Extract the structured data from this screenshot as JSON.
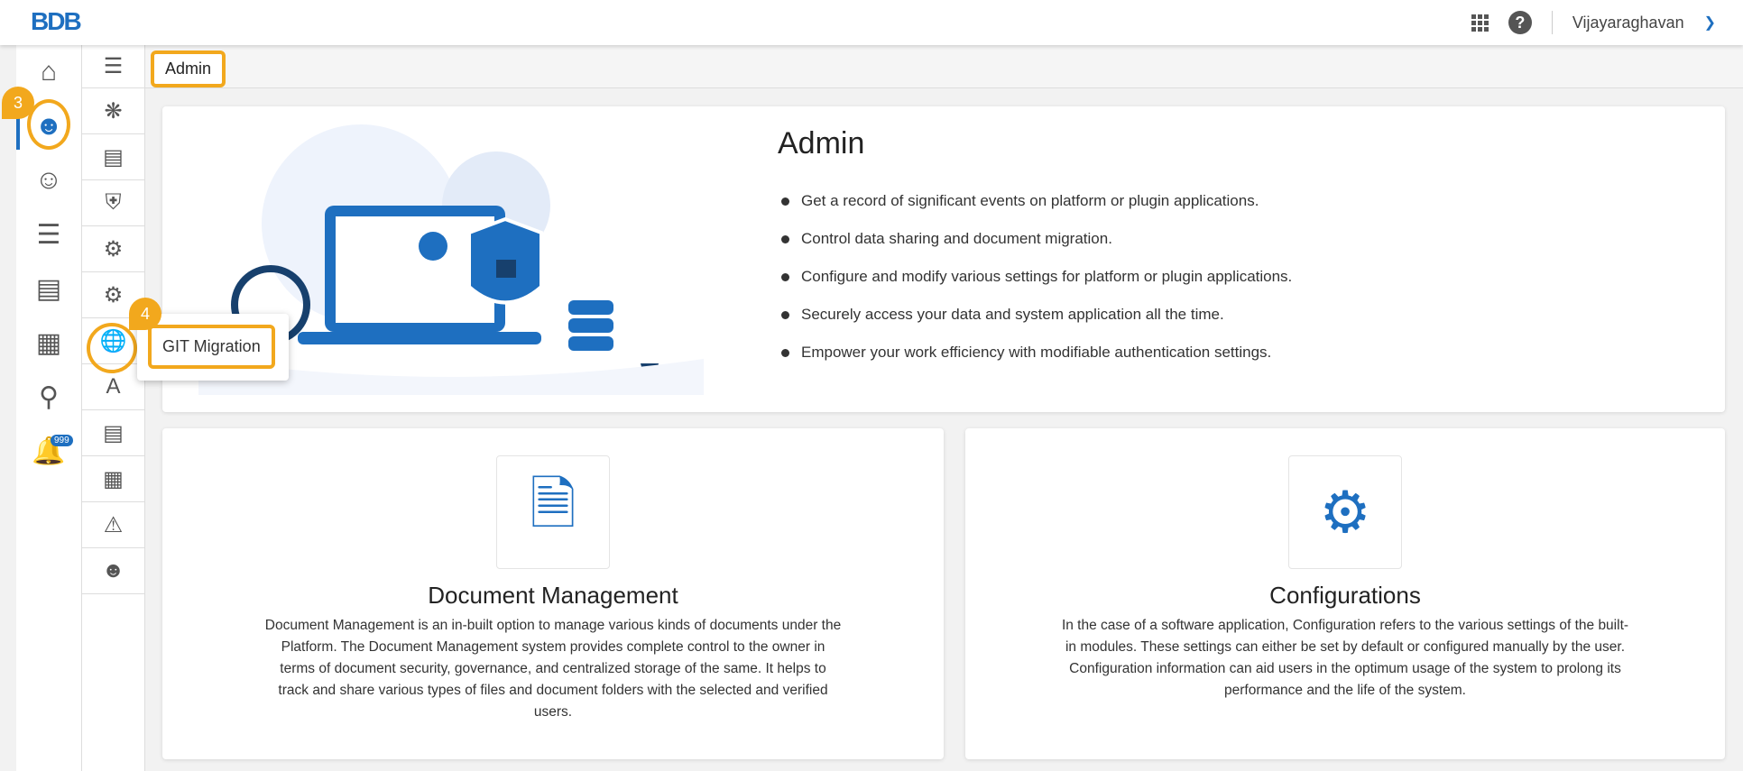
{
  "header": {
    "logo": "BDB",
    "user": "Vijayaraghavan"
  },
  "breadcrumb": "Admin",
  "tooltip": "GIT Migration",
  "steps": {
    "s3": "3",
    "s4": "4"
  },
  "notifications_badge": "999",
  "banner": {
    "title": "Admin",
    "bullets": [
      "Get a record of significant events on platform or plugin applications.",
      "Control data sharing and document migration.",
      "Configure and modify various settings for platform or plugin applications.",
      "Securely access your data and system application all the time.",
      "Empower your work efficiency with modifiable authentication settings."
    ]
  },
  "modules": [
    {
      "title": "Document Management",
      "description": "Document Management is an in-built option to manage various kinds of documents under the Platform. The Document Management system provides complete control to the owner in terms of document security, governance, and centralized storage of the same. It helps to track and share various types of files and document folders with the selected and verified users."
    },
    {
      "title": "Configurations",
      "description": "In the case of a software application, Configuration refers to the various settings of the built-in modules. These settings can either be set by default or configured manually by the user. Configuration information can aid users in the optimum usage of the system to prolong its performance and the life of the system."
    }
  ]
}
